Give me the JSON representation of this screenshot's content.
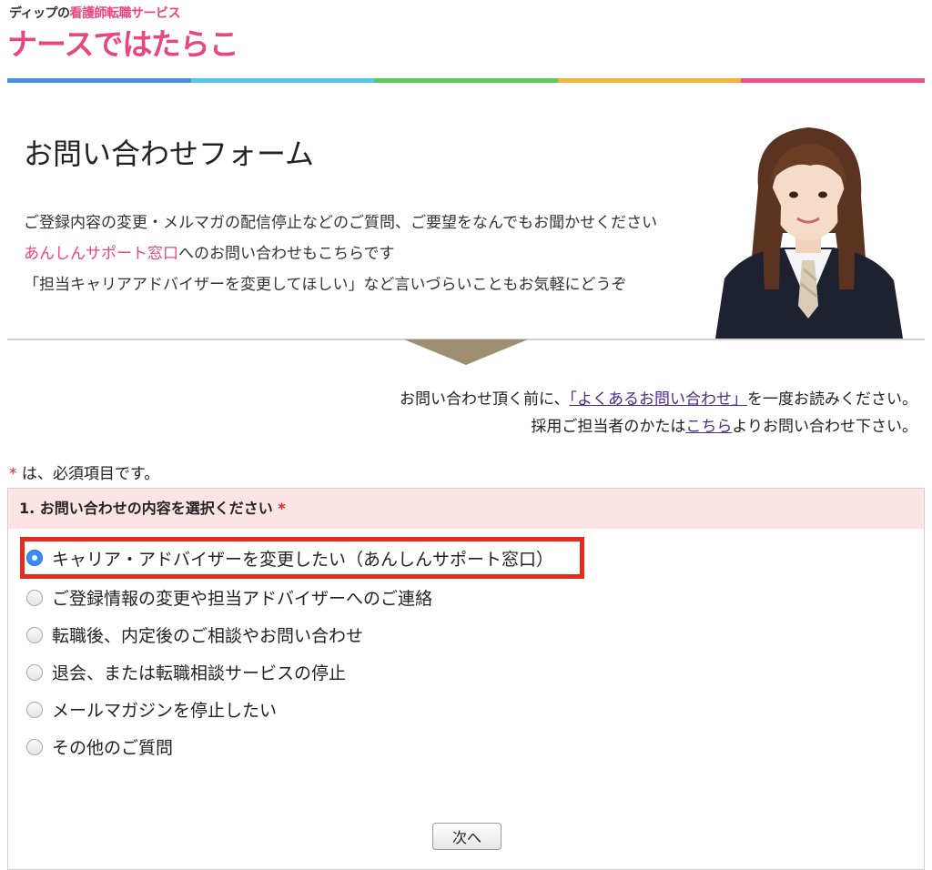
{
  "logo": {
    "sub_prefix": "ディップの",
    "sub_accent": "看護師転職サービス",
    "main": "ナースではたらこ"
  },
  "colors": {
    "brand_pink": "#e8467c",
    "bar": [
      "#4a90e2",
      "#4fc8ec",
      "#5cc95a",
      "#f5b335",
      "#ef4d8a"
    ],
    "highlight_red": "#e52b1e",
    "header_pink": "#fde4e4"
  },
  "hero": {
    "title": "お問い合わせフォーム",
    "line1": "ご登録内容の変更・メルマガの配信停止などのご質問、ご要望をなんでもお聞かせください",
    "line2_link": "あんしんサポート窓口",
    "line2_rest": "へのお問い合わせもこちらです",
    "line3": "「担当キャリアアドバイザーを変更してほしい」など言いづらいこともお気軽にどうぞ"
  },
  "notice": {
    "l1_pre": "お問い合わせ頂く前に、",
    "l1_link": "「よくあるお問い合わせ」",
    "l1_post": "を一度お読みください。",
    "l2_pre": "採用ご担当者のかたは",
    "l2_link": "こちら",
    "l2_post": "よりお問い合わせ下さい。"
  },
  "required_note": {
    "star": "*",
    "text": " は、必須項目です。"
  },
  "question": {
    "label": "1. お問い合わせの内容を選択ください",
    "star": "*",
    "options": [
      {
        "label": "キャリア・アドバイザーを変更したい（あんしんサポート窓口）",
        "checked": true
      },
      {
        "label": "ご登録情報の変更や担当アドバイザーへのご連絡",
        "checked": false
      },
      {
        "label": "転職後、内定後のご相談やお問い合わせ",
        "checked": false
      },
      {
        "label": "退会、または転職相談サービスの停止",
        "checked": false
      },
      {
        "label": "メールマガジンを停止したい",
        "checked": false
      },
      {
        "label": "その他のご質問",
        "checked": false
      }
    ]
  },
  "next_button": "次へ"
}
